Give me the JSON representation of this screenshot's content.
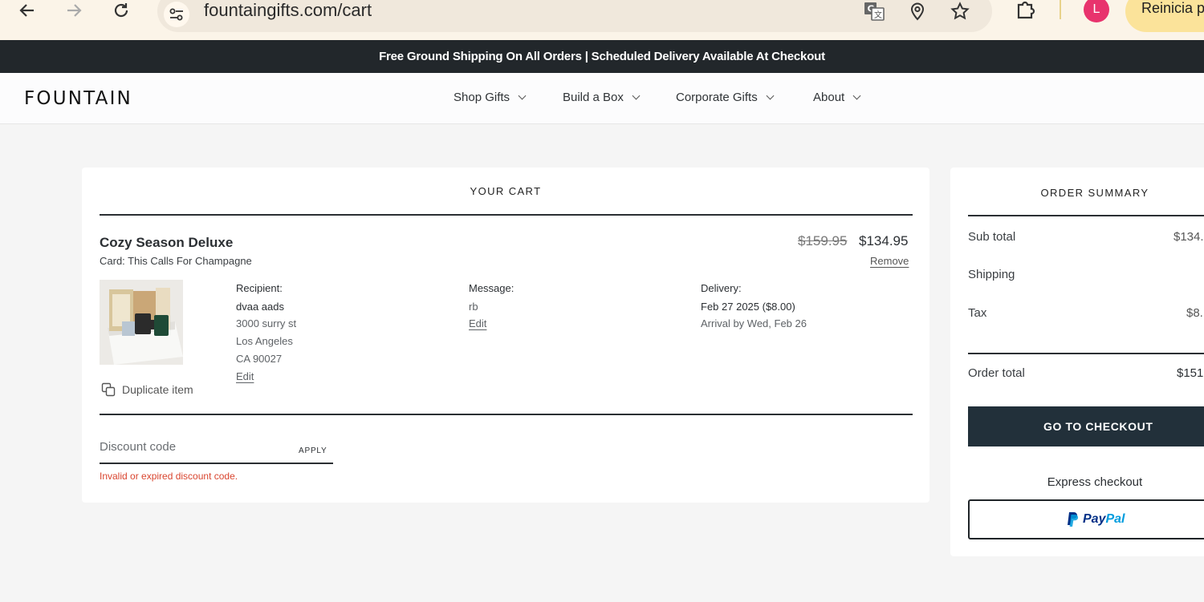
{
  "browser": {
    "url": "fountaingifts.com/cart",
    "avatar_letter": "L",
    "restart_label": "Reinicia p"
  },
  "announcement": "Free Ground Shipping On All Orders | Scheduled Delivery Available At Checkout",
  "header": {
    "logo": "FOUNTAIN",
    "menu": [
      {
        "label": "Shop Gifts"
      },
      {
        "label": "Build a Box"
      },
      {
        "label": "Corporate Gifts"
      },
      {
        "label": "About"
      }
    ]
  },
  "cart": {
    "title": "YOUR CART",
    "item": {
      "name": "Cozy Season Deluxe",
      "card": "Card: This Calls For Champagne",
      "price_original": "$159.95",
      "price_sale": "$134.95",
      "remove_label": "Remove",
      "duplicate_label": "Duplicate item",
      "recipient": {
        "label": "Recipient:",
        "name": "dvaa aads",
        "street": "3000 surry st",
        "city": "Los Angeles",
        "state_zip": "CA 90027",
        "edit_label": "Edit"
      },
      "message": {
        "label": "Message:",
        "text": "rb",
        "edit_label": "Edit"
      },
      "delivery": {
        "label": "Delivery:",
        "date": "Feb 27 2025 ($8.00)",
        "arrival": "Arrival by Wed, Feb 26"
      }
    },
    "discount": {
      "placeholder": "Discount code",
      "apply_label": "APPLY",
      "error": "Invalid or expired discount code."
    }
  },
  "summary": {
    "title": "ORDER SUMMARY",
    "subtotal_label": "Sub total",
    "subtotal_value": "$134.",
    "shipping_label": "Shipping",
    "tax_label": "Tax",
    "tax_value": "$8.",
    "total_label": "Order total",
    "total_value": "$151.",
    "checkout_label": "GO TO CHECKOUT",
    "express_label": "Express checkout",
    "paypal_pay": "Pay",
    "paypal_pal": "Pal"
  },
  "colors": {
    "announcement_bg": "#22272b",
    "checkout_bg": "#22303a",
    "error": "#d9452f",
    "paypal_dark": "#003087",
    "paypal_light": "#009cde",
    "avatar": "#e8336d"
  }
}
